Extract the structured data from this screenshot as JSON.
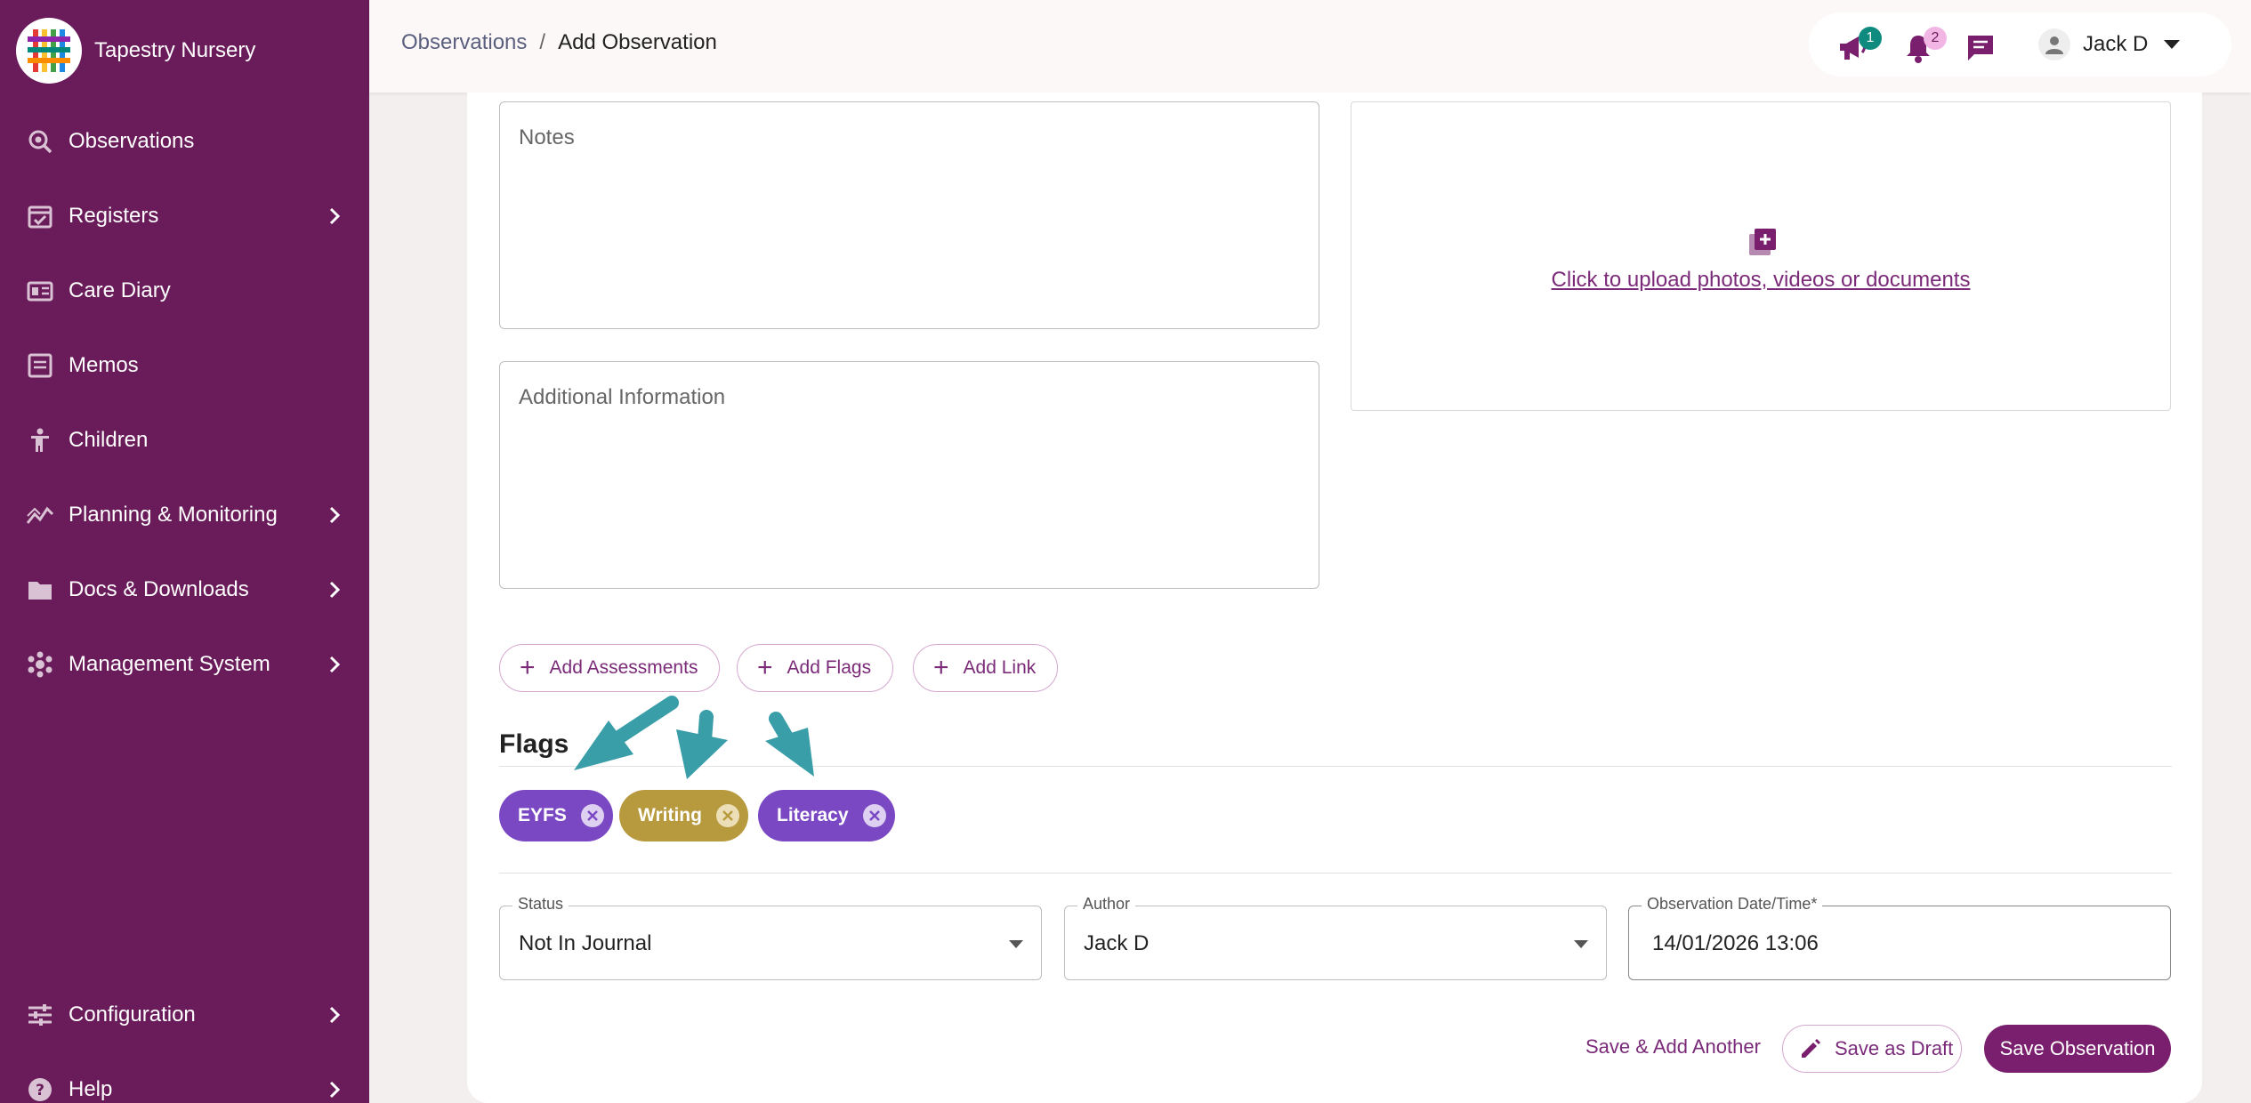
{
  "app": {
    "name": "Tapestry Nursery"
  },
  "colors": {
    "sidebar": "#6a1b5a",
    "accent": "#7a1f6e",
    "flag_eyfs": "#7b48c4",
    "flag_writing": "#b89a3e",
    "flag_literacy": "#7b48c4",
    "arrow": "#3a9ea8"
  },
  "sidebar": {
    "items": [
      {
        "label": "Observations",
        "icon": "magnify-eye-icon",
        "has_submenu": false
      },
      {
        "label": "Registers",
        "icon": "calendar-check-icon",
        "has_submenu": true
      },
      {
        "label": "Care Diary",
        "icon": "book-icon",
        "has_submenu": false
      },
      {
        "label": "Memos",
        "icon": "memo-icon",
        "has_submenu": false
      },
      {
        "label": "Children",
        "icon": "child-icon",
        "has_submenu": false
      },
      {
        "label": "Planning & Monitoring",
        "icon": "chart-line-icon",
        "has_submenu": true
      },
      {
        "label": "Docs & Downloads",
        "icon": "folder-icon",
        "has_submenu": true
      },
      {
        "label": "Management System",
        "icon": "cluster-icon",
        "has_submenu": true
      },
      {
        "label": "Configuration",
        "icon": "sliders-icon",
        "has_submenu": true
      },
      {
        "label": "Help",
        "icon": "help-icon",
        "has_submenu": true
      }
    ]
  },
  "header": {
    "breadcrumb": {
      "parent": "Observations",
      "separator": "/",
      "current": "Add Observation"
    },
    "announcements_badge": "1",
    "notifications_badge": "2",
    "user_name": "Jack D"
  },
  "form": {
    "notes_placeholder": "Notes",
    "additional_placeholder": "Additional Information",
    "upload_text": "Click to upload photos, videos or documents",
    "add_assessments": "Add Assessments",
    "add_flags": "Add Flags",
    "add_link": "Add Link",
    "flags_title": "Flags",
    "flags": [
      {
        "label": "EYFS"
      },
      {
        "label": "Writing"
      },
      {
        "label": "Literacy"
      }
    ],
    "status": {
      "label": "Status",
      "value": "Not In Journal"
    },
    "author": {
      "label": "Author",
      "value": "Jack D"
    },
    "date": {
      "label": "Observation Date/Time*",
      "value": "14/01/2026 13:06"
    }
  },
  "actions": {
    "save_add_another": "Save & Add Another",
    "save_draft": "Save as Draft",
    "save_observation": "Save Observation"
  }
}
